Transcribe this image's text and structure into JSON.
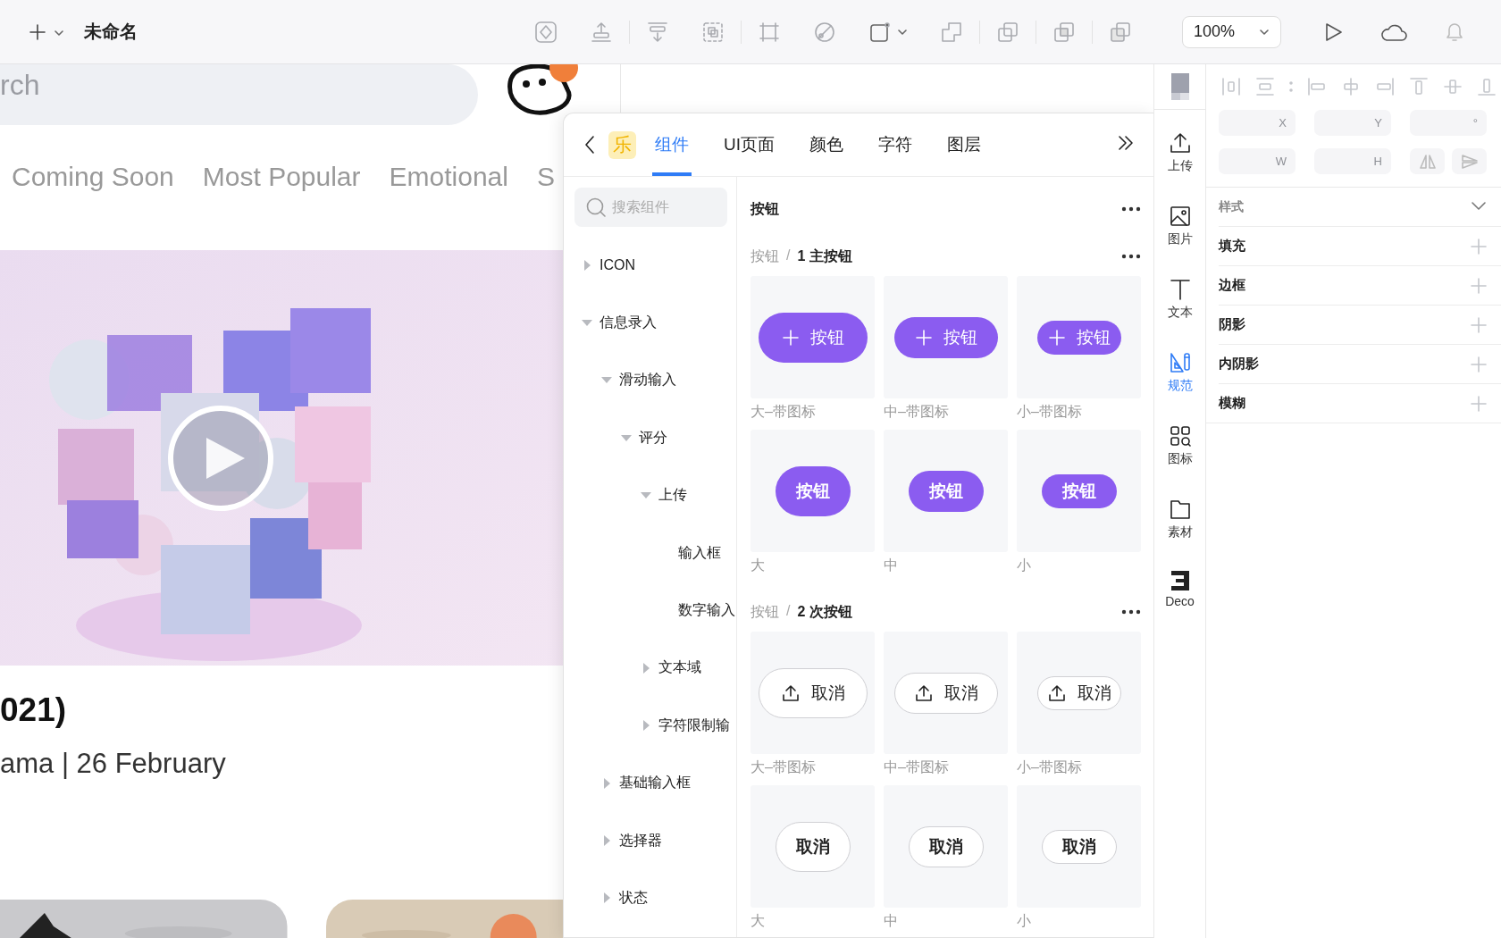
{
  "toolbar": {
    "title": "未命名",
    "zoom": "100%"
  },
  "canvas": {
    "search": {
      "value": "rch"
    },
    "categories": [
      {
        "label": "Coming Soon"
      },
      {
        "label": "Most Popular"
      },
      {
        "label": "Emotional"
      },
      {
        "label": "S"
      }
    ],
    "title": "021)",
    "subtitle": "ama | 26 February"
  },
  "panel": {
    "badge": "乐",
    "tabs": [
      {
        "label": "组件",
        "selected": true
      },
      {
        "label": "UI页面",
        "selected": false
      },
      {
        "label": "颜色",
        "selected": false
      },
      {
        "label": "字符",
        "selected": false
      },
      {
        "label": "图层",
        "selected": false
      }
    ],
    "search": {
      "placeholder": "搜索组件"
    },
    "tree": [
      {
        "label": "ICON",
        "expanded": false
      },
      {
        "label": "信息录入",
        "expanded": true,
        "children": [
          {
            "label": "滑动输入",
            "expanded": true,
            "children": [
              {
                "label": "评分",
                "expanded": true,
                "children": [
                  {
                    "label": "上传",
                    "expanded": true,
                    "children": [
                      {
                        "label": "输入框"
                      },
                      {
                        "label": "数字输入"
                      }
                    ]
                  },
                  {
                    "label": "文本域",
                    "expanded": false
                  },
                  {
                    "label": "字符限制输",
                    "expanded": false
                  }
                ]
              }
            ]
          },
          {
            "label": "基础输入框",
            "expanded": false
          },
          {
            "label": "选择器",
            "expanded": false
          },
          {
            "label": "状态",
            "expanded": false
          }
        ]
      }
    ],
    "heading": "按钮",
    "sections": [
      {
        "kind": "primary",
        "path": "按钮",
        "separator": "/",
        "title": "1 主按钮",
        "items": [
          {
            "label": "按钮",
            "kind": "large",
            "with_icon": true,
            "caption": "大–带图标"
          },
          {
            "label": "按钮",
            "kind": "medium",
            "with_icon": true,
            "caption": "中–带图标"
          },
          {
            "label": "按钮",
            "kind": "small",
            "with_icon": true,
            "caption": "小–带图标"
          },
          {
            "label": "按钮",
            "kind": "large",
            "with_icon": false,
            "caption": "大"
          },
          {
            "label": "按钮",
            "kind": "medium",
            "with_icon": false,
            "caption": "中"
          },
          {
            "label": "按钮",
            "kind": "small",
            "with_icon": false,
            "caption": "小"
          }
        ]
      },
      {
        "kind": "secondary",
        "path": "按钮",
        "separator": "/",
        "title": "2 次按钮",
        "items": [
          {
            "label": "取消",
            "kind": "large",
            "with_icon": true,
            "caption": "大–带图标"
          },
          {
            "label": "取消",
            "kind": "medium",
            "with_icon": true,
            "caption": "中–带图标"
          },
          {
            "label": "取消",
            "kind": "small",
            "with_icon": true,
            "caption": "小–带图标"
          },
          {
            "label": "取消",
            "kind": "large",
            "with_icon": false,
            "caption": "大"
          },
          {
            "label": "取消",
            "kind": "medium",
            "with_icon": false,
            "caption": "中"
          },
          {
            "label": "取消",
            "kind": "small",
            "with_icon": false,
            "caption": "小"
          }
        ]
      }
    ]
  },
  "iconbar": [
    {
      "label": "上传",
      "selected": false
    },
    {
      "label": "图片",
      "selected": false
    },
    {
      "label": "文本",
      "selected": false
    },
    {
      "label": "规范",
      "selected": true
    },
    {
      "label": "图标",
      "selected": false
    },
    {
      "label": "素材",
      "selected": false
    },
    {
      "label": "Deco",
      "selected": false
    }
  ],
  "props": {
    "fields": [
      {
        "suffix": "X",
        "disabled": true
      },
      {
        "suffix": "Y",
        "disabled": true
      },
      {
        "suffix": "°",
        "disabled": true
      },
      {
        "suffix": "W",
        "disabled": true
      },
      {
        "suffix": "H",
        "disabled": true
      }
    ],
    "style_header": {
      "label": "样式",
      "expanded": true
    },
    "rows": [
      {
        "label": "填充"
      },
      {
        "label": "边框"
      },
      {
        "label": "阴影"
      },
      {
        "label": "内阴影"
      },
      {
        "label": "模糊"
      }
    ]
  }
}
